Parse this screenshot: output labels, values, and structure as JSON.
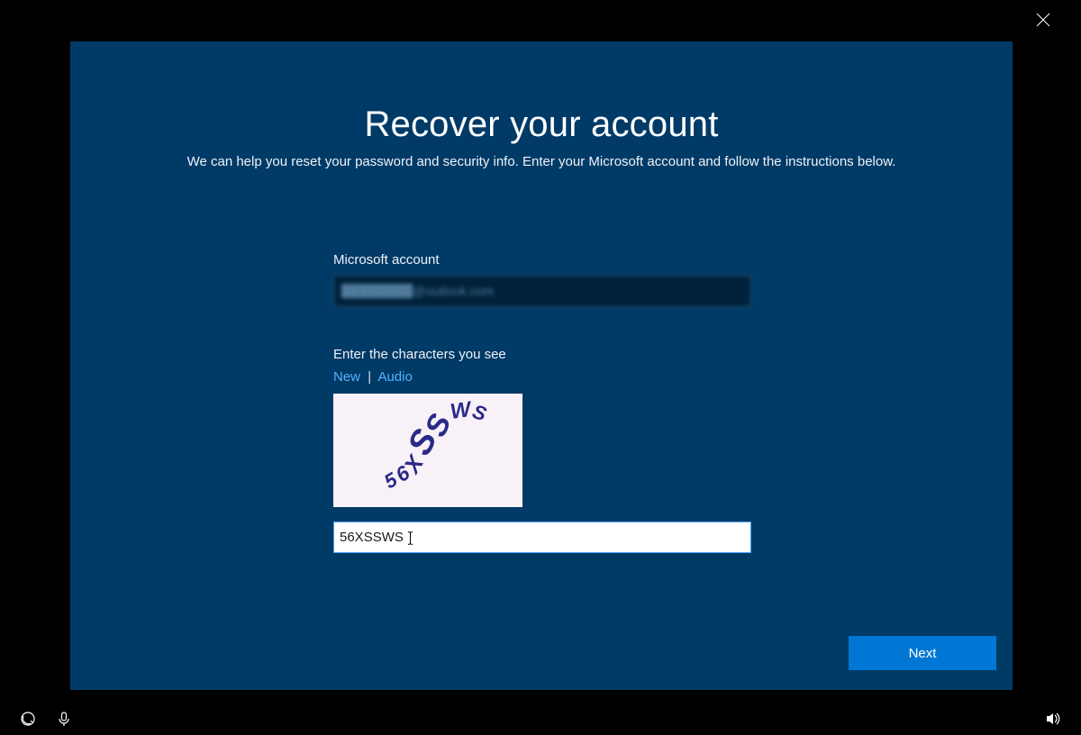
{
  "close_icon": "close",
  "heading": "Recover your account",
  "subheading": "We can help you reset your password and security info. Enter your Microsoft account and follow the instructions below.",
  "form": {
    "account_label": "Microsoft account",
    "account_value": "████████@outlook.com",
    "captcha_label": "Enter the characters you see",
    "captcha_links": {
      "new": "New",
      "sep": "|",
      "audio": "Audio"
    },
    "captcha_text": "56XSSWS",
    "captcha_input_value": "56XSSWS"
  },
  "next_button_label": "Next",
  "taskbar": {
    "ease_of_access_icon": "ease-of-access",
    "mic_icon": "dictation",
    "volume_icon": "volume"
  }
}
